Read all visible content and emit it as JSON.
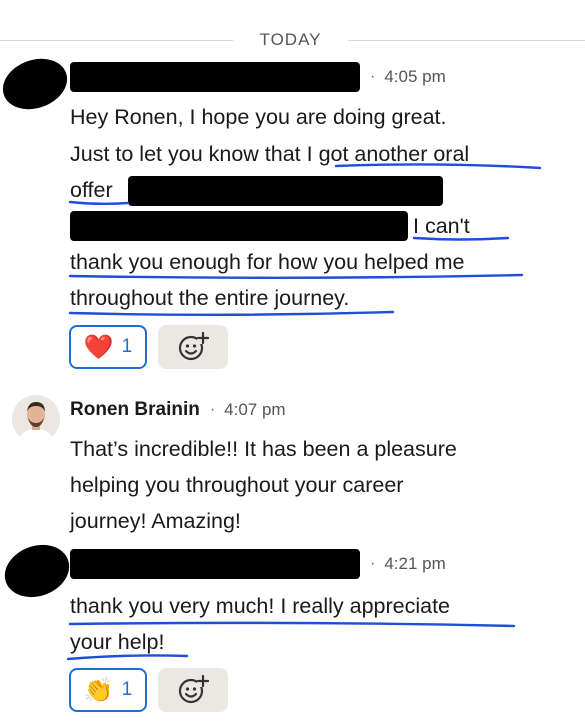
{
  "divider": {
    "label": "TODAY"
  },
  "messages": [
    {
      "time": "4:05 pm",
      "line1": "Hey Ronen, I hope you are doing great.",
      "line2": "Just to let you know that I got another oral",
      "line3": "offer",
      "line4": "I can't",
      "line5": "thank you enough for how you helped me",
      "line6": "throughout the entire journey.",
      "reaction": {
        "emoji": "❤️",
        "count": "1"
      }
    },
    {
      "sender": "Ronen Brainin",
      "time": "4:07 pm",
      "line1": "That’s incredible!! It has been a pleasure",
      "line2": "helping you throughout your career",
      "line3": "journey! Amazing!"
    },
    {
      "time": "4:21 pm",
      "line1": "thank you very much! I really appreciate",
      "line2": "your help!",
      "reaction": {
        "emoji": "👏",
        "count": "1"
      }
    }
  ],
  "icons": {
    "add_reaction": "add-reaction-icon",
    "avatar_photo": "avatar"
  },
  "colors": {
    "underline": "#1d4fd8",
    "reaction_border": "#1d6fd1"
  }
}
